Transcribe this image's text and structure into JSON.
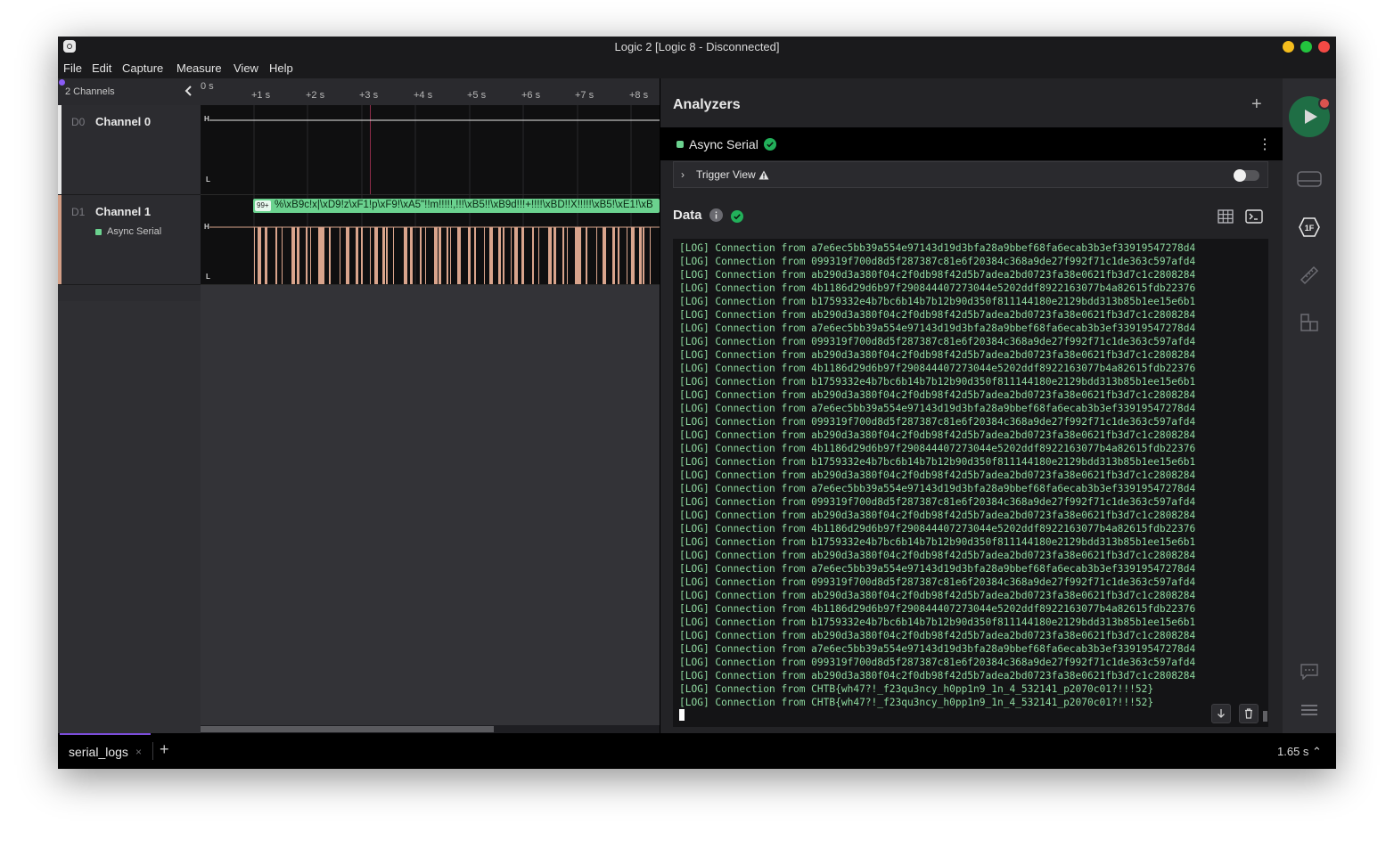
{
  "window": {
    "title": "Logic 2 [Logic 8 - Disconnected]"
  },
  "menu": [
    "File",
    "Edit",
    "Capture",
    "Measure",
    "View",
    "Help"
  ],
  "channels_header": "2 Channels",
  "channels": [
    {
      "id": "D0",
      "name": "Channel 0",
      "color": "#e8e8e8"
    },
    {
      "id": "D1",
      "name": "Channel 1",
      "color": "#d4a088",
      "analyzer": "Async Serial"
    }
  ],
  "timeline_ticks": [
    "0 s",
    "+1 s",
    "+2 s",
    "+3 s",
    "+4 s",
    "+5 s",
    "+6 s",
    "+7 s",
    "+8 s"
  ],
  "waveform": {
    "high_label": "H",
    "low_label": "L",
    "bubble_badge": "99+",
    "bubble_text": "%\\xB9c!x|\\xD9!z\\xF1!p\\xF9!\\xA5\"!!m!!!!!,!!!\\xB5!!\\xB9d!!!+!!!!\\xBD!!X!!!!!\\xB5!\\xE1!\\xB",
    "signal_color": "#d9a48c"
  },
  "analyzers": {
    "title": "Analyzers",
    "add_icon": "+",
    "active": {
      "name": "Async Serial",
      "status": "ok"
    },
    "trigger_view": {
      "label": "Trigger View",
      "enabled": false
    },
    "data_title": "Data",
    "log_prefix": "[LOG] Connection from ",
    "log_sources": [
      "a7e6ec5bb39a554e97143d19d3bfa28a9bbef68fa6ecab3b3ef33919547278d4",
      "099319f700d8d5f287387c81e6f20384c368a9de27f992f71c1de363c597afd4",
      "ab290d3a380f04c2f0db98f42d5b7adea2bd0723fa38e0621fb3d7c1c2808284",
      "4b1186d29d6b97f290844407273044e5202ddf8922163077b4a82615fdb22376",
      "b1759332e4b7bc6b14b7b12b90d350f811144180e2129bdd313b85b1ee15e6b1",
      "ab290d3a380f04c2f0db98f42d5b7adea2bd0723fa38e0621fb3d7c1c2808284",
      "a7e6ec5bb39a554e97143d19d3bfa28a9bbef68fa6ecab3b3ef33919547278d4",
      "099319f700d8d5f287387c81e6f20384c368a9de27f992f71c1de363c597afd4",
      "ab290d3a380f04c2f0db98f42d5b7adea2bd0723fa38e0621fb3d7c1c2808284",
      "4b1186d29d6b97f290844407273044e5202ddf8922163077b4a82615fdb22376",
      "b1759332e4b7bc6b14b7b12b90d350f811144180e2129bdd313b85b1ee15e6b1",
      "ab290d3a380f04c2f0db98f42d5b7adea2bd0723fa38e0621fb3d7c1c2808284",
      "a7e6ec5bb39a554e97143d19d3bfa28a9bbef68fa6ecab3b3ef33919547278d4",
      "099319f700d8d5f287387c81e6f20384c368a9de27f992f71c1de363c597afd4",
      "ab290d3a380f04c2f0db98f42d5b7adea2bd0723fa38e0621fb3d7c1c2808284",
      "4b1186d29d6b97f290844407273044e5202ddf8922163077b4a82615fdb22376",
      "b1759332e4b7bc6b14b7b12b90d350f811144180e2129bdd313b85b1ee15e6b1",
      "ab290d3a380f04c2f0db98f42d5b7adea2bd0723fa38e0621fb3d7c1c2808284",
      "a7e6ec5bb39a554e97143d19d3bfa28a9bbef68fa6ecab3b3ef33919547278d4",
      "099319f700d8d5f287387c81e6f20384c368a9de27f992f71c1de363c597afd4",
      "ab290d3a380f04c2f0db98f42d5b7adea2bd0723fa38e0621fb3d7c1c2808284",
      "4b1186d29d6b97f290844407273044e5202ddf8922163077b4a82615fdb22376",
      "b1759332e4b7bc6b14b7b12b90d350f811144180e2129bdd313b85b1ee15e6b1",
      "ab290d3a380f04c2f0db98f42d5b7adea2bd0723fa38e0621fb3d7c1c2808284",
      "a7e6ec5bb39a554e97143d19d3bfa28a9bbef68fa6ecab3b3ef33919547278d4",
      "099319f700d8d5f287387c81e6f20384c368a9de27f992f71c1de363c597afd4",
      "ab290d3a380f04c2f0db98f42d5b7adea2bd0723fa38e0621fb3d7c1c2808284",
      "4b1186d29d6b97f290844407273044e5202ddf8922163077b4a82615fdb22376",
      "b1759332e4b7bc6b14b7b12b90d350f811144180e2129bdd313b85b1ee15e6b1",
      "ab290d3a380f04c2f0db98f42d5b7adea2bd0723fa38e0621fb3d7c1c2808284",
      "a7e6ec5bb39a554e97143d19d3bfa28a9bbef68fa6ecab3b3ef33919547278d4",
      "099319f700d8d5f287387c81e6f20384c368a9de27f992f71c1de363c597afd4",
      "ab290d3a380f04c2f0db98f42d5b7adea2bd0723fa38e0621fb3d7c1c2808284",
      "CHTB{wh47?!_f23qu3ncy_h0pp1n9_1n_4_532141_p2070c01?!!!52}",
      "CHTB{wh47?!_f23qu3ncy_h0pp1n9_1n_4_532141_p2070c01?!!!52}"
    ]
  },
  "tabs": [
    {
      "label": "serial_logs"
    }
  ],
  "status": {
    "duration": "1.65 s ⌃"
  },
  "colors": {
    "accent": "#7c4ddb",
    "success": "#22b05a",
    "play": "#1f6e45",
    "log_text": "#8fdba0"
  }
}
